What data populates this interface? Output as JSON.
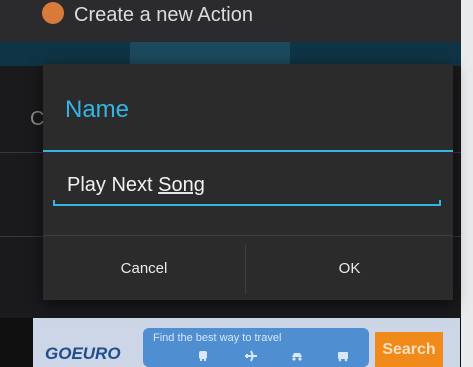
{
  "app": {
    "title": "Create a new Action"
  },
  "background": {
    "peek_letter": "C"
  },
  "dialog": {
    "title": "Name",
    "input_value_before": "Play Next ",
    "input_value_flagged": "Song",
    "cancel_label": "Cancel",
    "ok_label": "OK"
  },
  "ad": {
    "logo": "GOEURO",
    "tagline": "Find the best way to travel",
    "search_label": "Search",
    "icons": [
      "train-icon",
      "plane-icon",
      "car-icon",
      "bus-icon"
    ]
  },
  "colors": {
    "accent": "#33b5e5",
    "dialog_bg": "#2b2b2b",
    "ad_button": "#f08a1a"
  }
}
